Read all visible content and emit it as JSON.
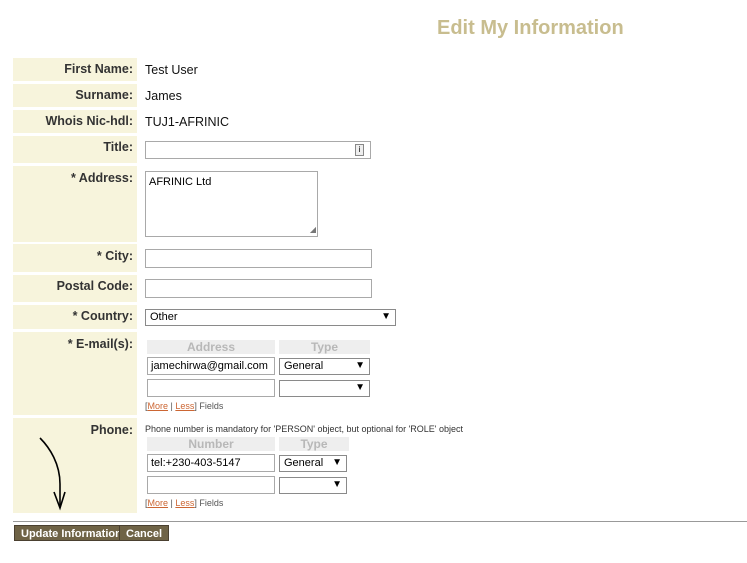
{
  "title": "Edit My Information",
  "labels": {
    "first_name": "First Name:",
    "surname": "Surname:",
    "nic": "Whois Nic-hdl:",
    "title": "Title:",
    "address": "* Address:",
    "city": "* City:",
    "postal": "Postal Code:",
    "country": "* Country:",
    "emails": "* E-mail(s):",
    "phone": "Phone:"
  },
  "values": {
    "first_name": "Test User",
    "surname": "James",
    "nic": "TUJ1-AFRINIC",
    "title": "",
    "address": "AFRINIC Ltd",
    "city": "",
    "postal": "",
    "country": "Other"
  },
  "emails": {
    "col_address": "Address",
    "col_type": "Type",
    "row1_address": "jamechirwa@gmail.com",
    "row1_type": "General",
    "row2_address": "",
    "row2_type": ""
  },
  "phone": {
    "note": "Phone number is mandatory for 'PERSON' object, but optional for 'ROLE' object",
    "col_number": "Number",
    "col_type": "Type",
    "row1_number": "tel:+230-403-5147",
    "row1_type": "General",
    "row2_number": "",
    "row2_type": ""
  },
  "more_less": {
    "open": "[",
    "more": "More",
    "sep": " | ",
    "less": "Less",
    "close": "] Fields"
  },
  "buttons": {
    "update": "Update Information",
    "cancel": "Cancel"
  },
  "colors": {
    "title": "#c8bd8f",
    "label_bg": "#f7f4dc",
    "button_bg": "#6f6346",
    "link": "#cc6633"
  }
}
